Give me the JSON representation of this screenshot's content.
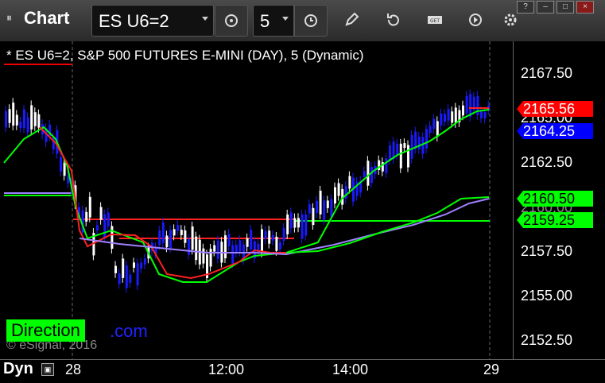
{
  "toolbar": {
    "app_title": "Chart",
    "symbol": "ES U6=2",
    "interval": "5",
    "icons": [
      "pause-icon",
      "link-icon",
      "clock-icon",
      "pencil-icon",
      "refresh-icon",
      "get-icon",
      "play-icon",
      "gear-icon"
    ]
  },
  "window_controls": [
    "?",
    "–",
    "□",
    "×"
  ],
  "chart": {
    "title": "* ES U6=2, S&P 500 FUTURES E-MINI (DAY), 5 (Dynamic)",
    "price_ticks": [
      "2167.50",
      "2165.00",
      "2162.50",
      "2157.50",
      "2155.00",
      "2152.50"
    ],
    "time_ticks": [
      "28",
      "12:00",
      "14:00",
      "29"
    ],
    "badges": [
      {
        "value": "2165.56",
        "color": "#ff0000",
        "text_color": "#ffffff"
      },
      {
        "value": "2164.25",
        "color": "#0000ff",
        "text_color": "#ffffff"
      },
      {
        "value": "2160.50",
        "color": "#00ff00",
        "text_color": "#000000"
      },
      {
        "value": "2159.25",
        "color": "#00ff00",
        "text_color": "#000000"
      }
    ],
    "hidden_label": "2160.00",
    "footer_mode": "Dyn",
    "watermark": "© eSignal, 2016",
    "brand": "Direction",
    "brand_tail": ".com",
    "colors": {
      "up": "#ffffff",
      "down": "#1a1aff",
      "ma_fast": "#ff2020",
      "ma_slow": "#00ff00",
      "vwap": "#a080ff"
    }
  }
}
